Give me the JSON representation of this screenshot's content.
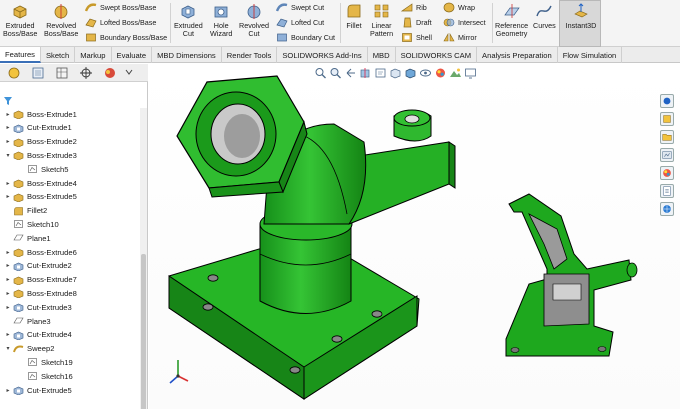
{
  "ribbon": {
    "big_items": [
      {
        "id": "extruded-boss",
        "line1": "Extruded",
        "line2": "Boss/Base"
      },
      {
        "id": "revolved-boss",
        "line1": "Revolved",
        "line2": "Boss/Base"
      },
      {
        "id": "extruded-cut",
        "line1": "Extruded",
        "line2": "Cut"
      },
      {
        "id": "hole-wizard",
        "line1": "Hole",
        "line2": "Wizard"
      },
      {
        "id": "revolved-cut",
        "line1": "Revolved",
        "line2": "Cut"
      },
      {
        "id": "fillet",
        "line1": "Fillet",
        "line2": ""
      },
      {
        "id": "linear-pattern",
        "line1": "Linear",
        "line2": "Pattern"
      },
      {
        "id": "reference-geometry",
        "line1": "Reference",
        "line2": "Geometry"
      },
      {
        "id": "curves",
        "line1": "Curves",
        "line2": ""
      },
      {
        "id": "instant3d",
        "line1": "Instant3D",
        "line2": ""
      }
    ],
    "small_items": {
      "swept_boss": "Swept Boss/Base",
      "lofted_boss": "Lofted Boss/Base",
      "boundary_boss": "Boundary Boss/Base",
      "swept_cut": "Swept Cut",
      "lofted_cut": "Lofted Cut",
      "boundary_cut": "Boundary Cut",
      "rib": "Rib",
      "draft": "Draft",
      "shell": "Shell",
      "wrap": "Wrap",
      "intersect": "Intersect",
      "mirror": "Mirror"
    }
  },
  "tabs": [
    "Features",
    "Sketch",
    "Markup",
    "Evaluate",
    "MBD Dimensions",
    "Render Tools",
    "SOLIDWORKS Add-Ins",
    "MBD",
    "SOLIDWORKS CAM",
    "Analysis Preparation",
    "Flow Simulation"
  ],
  "active_tab": "Features",
  "feature_tree": [
    {
      "label": "Boss-Extrude1",
      "icon": "extrude-icon",
      "level": 0,
      "expander": "collapsed"
    },
    {
      "label": "Cut-Extrude1",
      "icon": "cut-icon",
      "level": 0,
      "expander": "collapsed"
    },
    {
      "label": "Boss-Extrude2",
      "icon": "extrude-icon",
      "level": 0,
      "expander": "collapsed"
    },
    {
      "label": "Boss-Extrude3",
      "icon": "extrude-icon",
      "level": 0,
      "expander": "expanded"
    },
    {
      "label": "Sketch5",
      "icon": "sketch-icon",
      "level": 1,
      "expander": "none"
    },
    {
      "label": "Boss-Extrude4",
      "icon": "extrude-icon",
      "level": 0,
      "expander": "collapsed"
    },
    {
      "label": "Boss-Extrude5",
      "icon": "extrude-icon",
      "level": 0,
      "expander": "collapsed"
    },
    {
      "label": "Fillet2",
      "icon": "fillet-icon",
      "level": 0,
      "expander": "none"
    },
    {
      "label": "Sketch10",
      "icon": "sketch-icon",
      "level": 0,
      "expander": "none"
    },
    {
      "label": "Plane1",
      "icon": "plane-icon",
      "level": 0,
      "expander": "none"
    },
    {
      "label": "Boss-Extrude6",
      "icon": "extrude-icon",
      "level": 0,
      "expander": "collapsed"
    },
    {
      "label": "Cut-Extrude2",
      "icon": "cut-icon",
      "level": 0,
      "expander": "collapsed"
    },
    {
      "label": "Boss-Extrude7",
      "icon": "extrude-icon",
      "level": 0,
      "expander": "collapsed"
    },
    {
      "label": "Boss-Extrude8",
      "icon": "extrude-icon",
      "level": 0,
      "expander": "collapsed"
    },
    {
      "label": "Cut-Extrude3",
      "icon": "cut-icon",
      "level": 0,
      "expander": "collapsed"
    },
    {
      "label": "Plane3",
      "icon": "plane-icon",
      "level": 0,
      "expander": "none"
    },
    {
      "label": "Cut-Extrude4",
      "icon": "cut-icon",
      "level": 0,
      "expander": "collapsed"
    },
    {
      "label": "Sweep2",
      "icon": "sweep-icon",
      "level": 0,
      "expander": "expanded"
    },
    {
      "label": "Sketch19",
      "icon": "sketch-icon",
      "level": 1,
      "expander": "none"
    },
    {
      "label": "Sketch16",
      "icon": "sketch-icon",
      "level": 1,
      "expander": "none"
    },
    {
      "label": "Cut-Extrude5",
      "icon": "cut-icon",
      "level": 0,
      "expander": "collapsed"
    }
  ],
  "colors": {
    "model_green": "#22b022",
    "model_green_dark": "#178517",
    "section_grey": "#9a9a9a",
    "accent_blue": "#3a6fb7"
  }
}
